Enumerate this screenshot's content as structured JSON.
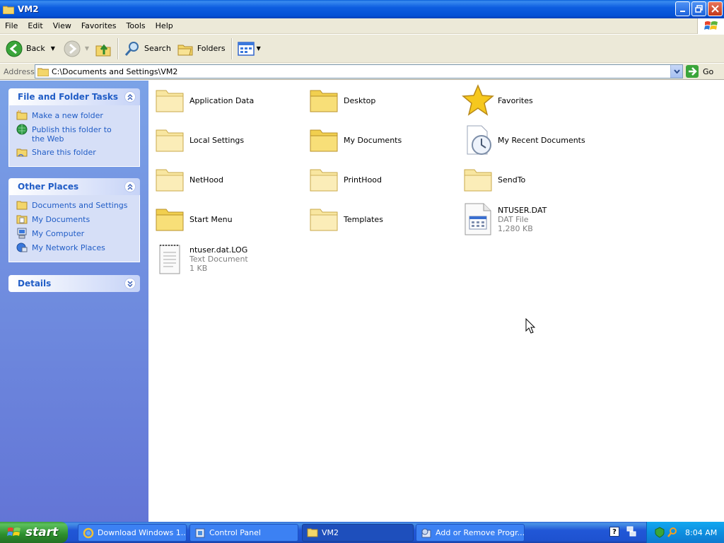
{
  "window": {
    "title": "VM2"
  },
  "menu": [
    "File",
    "Edit",
    "View",
    "Favorites",
    "Tools",
    "Help"
  ],
  "toolbar": {
    "back": "Back",
    "search": "Search",
    "folders": "Folders"
  },
  "address": {
    "label": "Address",
    "value": "C:\\Documents and Settings\\VM2",
    "go": "Go"
  },
  "left": {
    "file_tasks": {
      "title": "File and Folder Tasks",
      "items": [
        "Make a new folder",
        "Publish this folder to the Web",
        "Share this folder"
      ]
    },
    "other_places": {
      "title": "Other Places",
      "items": [
        "Documents and Settings",
        "My Documents",
        "My Computer",
        "My Network Places"
      ]
    },
    "details": {
      "title": "Details"
    }
  },
  "items": [
    {
      "name": "Application Data",
      "icon": "folder-icon"
    },
    {
      "name": "Desktop",
      "icon": "folder-icon"
    },
    {
      "name": "Favorites",
      "icon": "star-icon"
    },
    {
      "name": "Local Settings",
      "icon": "folder-icon"
    },
    {
      "name": "My Documents",
      "icon": "folder-icon"
    },
    {
      "name": "My Recent Documents",
      "icon": "recent-documents-icon"
    },
    {
      "name": "NetHood",
      "icon": "folder-icon"
    },
    {
      "name": "PrintHood",
      "icon": "folder-icon"
    },
    {
      "name": "SendTo",
      "icon": "folder-icon"
    },
    {
      "name": "Start Menu",
      "icon": "folder-icon"
    },
    {
      "name": "Templates",
      "icon": "folder-icon"
    },
    {
      "name": "NTUSER.DAT",
      "type": "DAT File",
      "size": "1,280 KB",
      "icon": "dat-file-icon"
    },
    {
      "name": "ntuser.dat.LOG",
      "type": "Text Document",
      "size": "1 KB",
      "icon": "text-document-icon"
    }
  ],
  "taskbar": {
    "start": "start",
    "buttons": [
      "Download Windows 1...",
      "Control Panel",
      "VM2",
      "Add or Remove Progr..."
    ],
    "clock": "8:04 AM"
  }
}
